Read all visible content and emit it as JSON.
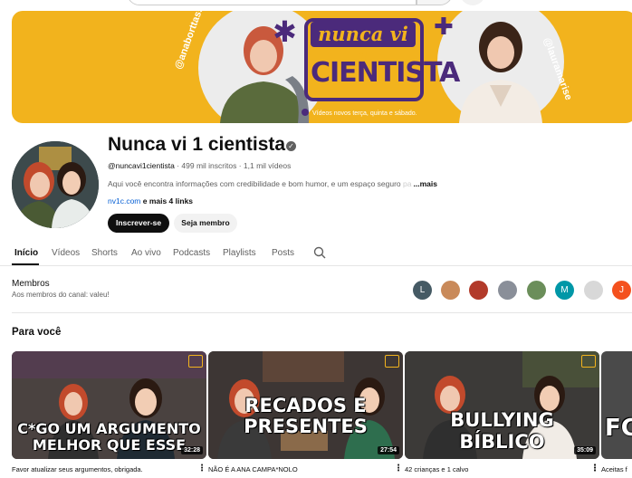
{
  "banner": {
    "handle_left": "@anaborttassa",
    "handle_right": "@lauramarise",
    "logo_top": "nunca vi 1",
    "logo_main": "CIENTISTA",
    "schedule": "Vídeos novos terça, quinta e sábado."
  },
  "channel": {
    "name": "Nunca vi 1 cientista",
    "handle": "@nuncavi1cientista",
    "stats": " · 499 mil inscritos · 1,1 mil vídeos",
    "description": "Aqui você encontra informações com credibilidade e bom humor, e um espaço seguro ",
    "description_fade": "pa",
    "more": "...mais",
    "link": "nv1c.com",
    "more_links": " e mais 4 links",
    "subscribe_label": "Inscrever-se",
    "member_label": "Seja membro"
  },
  "tabs": [
    {
      "label": "Início"
    },
    {
      "label": "Vídeos"
    },
    {
      "label": "Shorts"
    },
    {
      "label": "Ao vivo"
    },
    {
      "label": "Podcasts"
    },
    {
      "label": "Playlists"
    },
    {
      "label": "Posts"
    }
  ],
  "members": {
    "title": "Membros",
    "subtitle": "Aos membros do canal: valeu!",
    "avatars": [
      {
        "letter": "L",
        "color": "#455a64"
      },
      {
        "letter": "",
        "color": "#c98a5a"
      },
      {
        "letter": "",
        "color": "#b23a2a"
      },
      {
        "letter": "",
        "color": "#8a8f99"
      },
      {
        "letter": "",
        "color": "#6b8e5a"
      },
      {
        "letter": "M",
        "color": "#0097a7"
      },
      {
        "letter": "",
        "color": "#d8d8d8"
      },
      {
        "letter": "J",
        "color": "#f4511e"
      }
    ]
  },
  "section": {
    "title": "Para você"
  },
  "videos": [
    {
      "thumb_text_1": "C*GO UM ARGUMENTO",
      "thumb_text_2": "MELHOR QUE ESSE",
      "duration": "32:28",
      "title": "Favor atualizar seus argumentos, obrigada."
    },
    {
      "thumb_text_1": "RECADOS E",
      "thumb_text_2": "PRESENTES",
      "duration": "27:54",
      "title": "NÃO É A ANA CAMPA*NOLO"
    },
    {
      "thumb_text_1": "BULLYING",
      "thumb_text_2": "BÍBLICO",
      "duration": "35:09",
      "title": "42 crianças e 1 calvo"
    },
    {
      "thumb_text_1": "FC",
      "thumb_text_2": "",
      "duration": "",
      "title": "Aceitas f"
    }
  ],
  "colors": {
    "banner_yellow": "#f2b31d",
    "brand_purple": "#4b2a7b",
    "link_blue": "#065fd4"
  }
}
